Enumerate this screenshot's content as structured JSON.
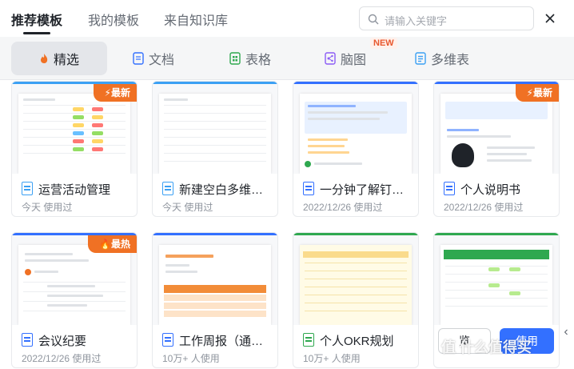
{
  "header": {
    "tabs": [
      "推荐模板",
      "我的模板",
      "来自知识库"
    ],
    "search_placeholder": "请输入关键字"
  },
  "filter": {
    "tabs": [
      "精选",
      "文档",
      "表格",
      "脑图",
      "多维表"
    ],
    "new_badge": "NEW"
  },
  "cards": [
    {
      "name": "运营活动管理",
      "meta": "今天 使用过",
      "ribbon": "最新",
      "type": "base",
      "bar": "#3ba0f4"
    },
    {
      "name": "新建空白多维…",
      "meta": "今天 使用过",
      "ribbon": "",
      "type": "base",
      "bar": "#3ba0f4"
    },
    {
      "name": "一分钟了解钉…",
      "meta": "2022/12/26 使用过",
      "ribbon": "",
      "type": "doc",
      "bar": "#3370ff"
    },
    {
      "name": "个人说明书",
      "meta": "2022/12/26 使用过",
      "ribbon": "最新",
      "type": "doc",
      "bar": "#3370ff"
    },
    {
      "name": "会议纪要",
      "meta": "2022/12/26 使用过",
      "ribbon": "最热",
      "type": "doc",
      "bar": "#3370ff"
    },
    {
      "name": "工作周报（通…",
      "meta": "10万+ 人使用",
      "ribbon": "",
      "type": "doc",
      "bar": "#3370ff"
    },
    {
      "name": "个人OKR规划",
      "meta": "10万+ 人使用",
      "ribbon": "",
      "type": "sheet",
      "bar": "#2fa84f"
    },
    {
      "name": "",
      "meta": "",
      "ribbon": "",
      "type": "sheet",
      "bar": "#2fa84f"
    }
  ],
  "actions": {
    "preview": "览",
    "use": "使用"
  },
  "watermark": "值 什么值得买",
  "colors": {
    "accent": "#3370ff",
    "sheet": "#2fa84f",
    "mind": "#8b5cf6",
    "ribbon": "#f07124"
  }
}
